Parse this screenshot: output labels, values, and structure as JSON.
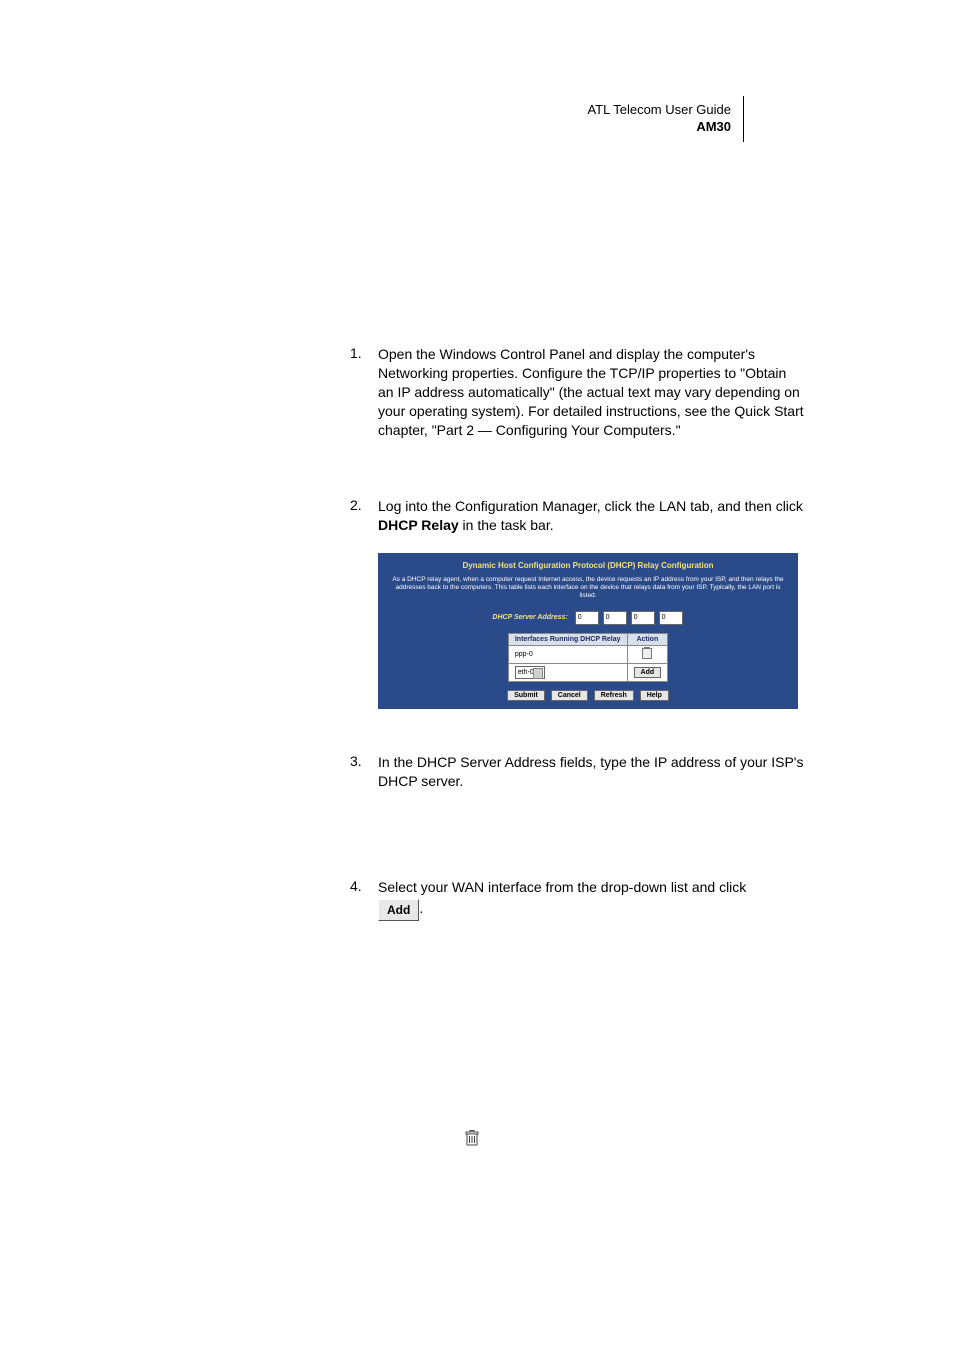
{
  "header": {
    "line1": "ATL Telecom User Guide",
    "line2": "AM30"
  },
  "steps": {
    "s1": {
      "num": "1.",
      "text": "Open the Windows Control Panel and display the computer's Networking properties. Configure the TCP/IP properties to \"Obtain an IP address automatically\" (the actual text may vary depending on your operating system). For detailed instructions, see the Quick Start chapter, \"Part 2 — Configuring Your Computers.\""
    },
    "s2": {
      "num": "2.",
      "pre": "Log into the Configuration Manager, click the LAN tab, and then click ",
      "bold": "DHCP Relay",
      "post": " in the task bar."
    },
    "s3": {
      "num": "3.",
      "text": "In the DHCP Server Address fields, type the IP address of your ISP's DHCP server."
    },
    "s4": {
      "num": "4.",
      "text": "Select your WAN interface from the drop-down list and click",
      "btn": "Add",
      "post": "."
    }
  },
  "panel": {
    "title": "Dynamic Host Configuration Protocol (DHCP) Relay Configuration",
    "desc": "As a DHCP relay agent, when a computer request Internet access, the device requests an IP address from your ISP, and then relays the addresses back to the computers. This table lists each interface on the device that relays data from your ISP. Typically, the LAN port is listed.",
    "addr_label": "DHCP Server Address:",
    "ip": [
      "0",
      "0",
      "0",
      "0"
    ],
    "th1": "Interfaces Running DHCP Relay",
    "th2": "Action",
    "row1_iface": "ppp-0",
    "row2_select": "eth-0",
    "row2_btn": "Add",
    "buttons": {
      "submit": "Submit",
      "cancel": "Cancel",
      "refresh": "Refresh",
      "help": "Help"
    }
  }
}
